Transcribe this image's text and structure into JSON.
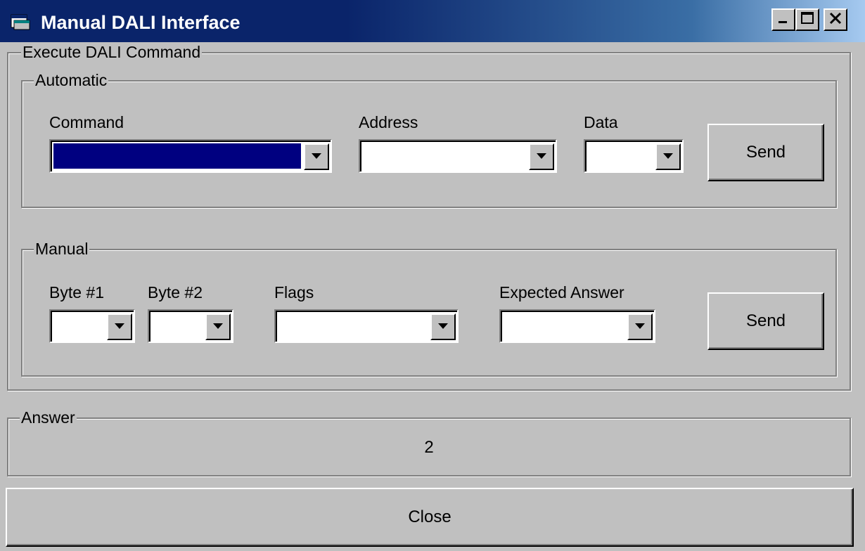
{
  "window": {
    "title": "Manual DALI Interface",
    "icon": "app-window-icon",
    "controls": {
      "minimize": "minimize-icon",
      "maximize": "maximize-icon",
      "close": "close-icon"
    }
  },
  "execute_group": {
    "label": "Execute DALI Command",
    "automatic": {
      "label": "Automatic",
      "command_label": "Command",
      "command_value": "",
      "address_label": "Address",
      "address_value": "",
      "data_label": "Data",
      "data_value": "",
      "send_label": "Send"
    },
    "manual": {
      "label": "Manual",
      "byte1_label": "Byte #1",
      "byte1_value": "",
      "byte2_label": "Byte #2",
      "byte2_value": "",
      "flags_label": "Flags",
      "flags_value": "",
      "expected_label": "Expected Answer",
      "expected_value": "",
      "send_label": "Send"
    }
  },
  "answer_group": {
    "label": "Answer",
    "value": "2"
  },
  "close_label": "Close",
  "colors": {
    "face": "#c0c0c0",
    "title_active": "#0a246a",
    "selection": "#000080"
  }
}
